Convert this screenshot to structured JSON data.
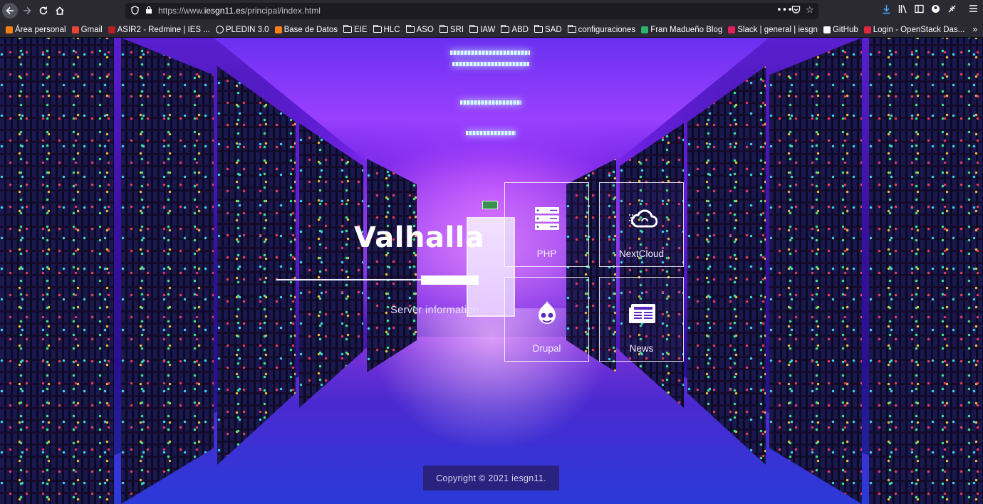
{
  "browser": {
    "url_prefix": "https://www.",
    "url_domain": "iesgn11.es",
    "url_path": "/principal/index.html",
    "icons": {
      "back": "back-arrow-icon",
      "forward": "forward-arrow-icon",
      "reload": "reload-icon",
      "home": "home-icon"
    }
  },
  "bookmarks": [
    {
      "label": "Área personal",
      "icon": "moodle-icon"
    },
    {
      "label": "Gmail",
      "icon": "gmail-icon"
    },
    {
      "label": "ASIR2 - Redmine | IES ...",
      "icon": "redmine-icon"
    },
    {
      "label": "PLEDIN 3.0",
      "icon": "globe-icon"
    },
    {
      "label": "Base de Datos",
      "icon": "moodle-icon"
    },
    {
      "label": "EIE",
      "icon": "folder-icon"
    },
    {
      "label": "HLC",
      "icon": "folder-icon"
    },
    {
      "label": "ASO",
      "icon": "folder-icon"
    },
    {
      "label": "SRI",
      "icon": "folder-icon"
    },
    {
      "label": "IAW",
      "icon": "folder-icon"
    },
    {
      "label": "ABD",
      "icon": "folder-icon"
    },
    {
      "label": "SAD",
      "icon": "folder-icon"
    },
    {
      "label": "configuraciones",
      "icon": "folder-icon"
    },
    {
      "label": "Fran Madueño Blog",
      "icon": "blog-icon"
    },
    {
      "label": "Slack | general | iesgn",
      "icon": "slack-icon"
    },
    {
      "label": "GitHub",
      "icon": "github-icon"
    },
    {
      "label": "Login - OpenStack Das...",
      "icon": "openstack-icon"
    }
  ],
  "hero": {
    "title": "Valhalla",
    "subtitle": "Server information"
  },
  "tiles": [
    {
      "label": "PHP",
      "icon": "server-icon"
    },
    {
      "label": "NextCloud",
      "icon": "cloud-icon"
    },
    {
      "label": "Drupal",
      "icon": "drupal-icon"
    },
    {
      "label": "News",
      "icon": "newspaper-icon"
    }
  ],
  "footer": {
    "copyright": "Copyright © 2021 iesgn11."
  }
}
